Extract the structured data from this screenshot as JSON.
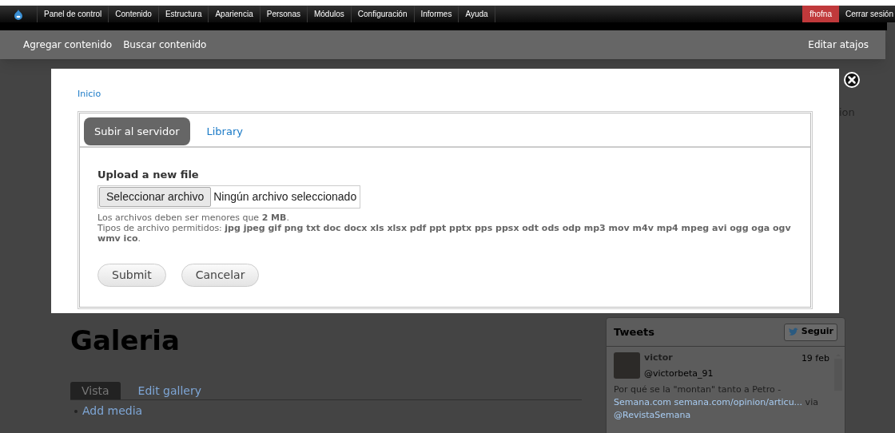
{
  "toolbar": {
    "menu": [
      "Panel de control",
      "Contenido",
      "Estructura",
      "Apariencia",
      "Personas",
      "Módulos",
      "Configuración",
      "Informes",
      "Ayuda"
    ],
    "user": "fhofna",
    "logout": "Cerrar sesión"
  },
  "shortcuts": {
    "items": [
      "Agregar contenido",
      "Buscar contenido"
    ],
    "edit": "Editar atajos"
  },
  "background": {
    "side_text": "ion",
    "title": "Galeria",
    "tabs": [
      {
        "label": "Vista",
        "selected": true
      },
      {
        "label": "Edit gallery",
        "selected": false
      }
    ],
    "links": [
      "Add media"
    ],
    "tweets": {
      "title": "Tweets",
      "follow": "Seguir",
      "tweet": {
        "name": "victor",
        "handle": "@victorbeta_91",
        "date": "19 feb",
        "text": "Por qué se la \"montan\" tanto a Petro -",
        "link": "Semana.com semana.com/opinion/articu...",
        "via": "via",
        "mention": "@RevistaSemana"
      }
    }
  },
  "modal": {
    "breadcrumb": "Inicio",
    "tabs": [
      {
        "label": "Subir al servidor",
        "selected": true
      },
      {
        "label": "Library",
        "selected": false
      }
    ],
    "upload": {
      "label": "Upload a new file",
      "button": "Seleccionar archivo",
      "filename": "Ningún archivo seleccionado",
      "size_note": "Los archivos deben ser menores que **2 MB**.",
      "types_note": "Tipos de archivo permitidos: **jpg jpeg gif png txt doc docx xls xlsx pdf ppt pptx pps ppsx odt ods odp mp3 mov m4v mp4 mpeg avi ogg oga ogv wmv ico**."
    },
    "buttons": [
      "Submit",
      "Cancelar"
    ]
  }
}
